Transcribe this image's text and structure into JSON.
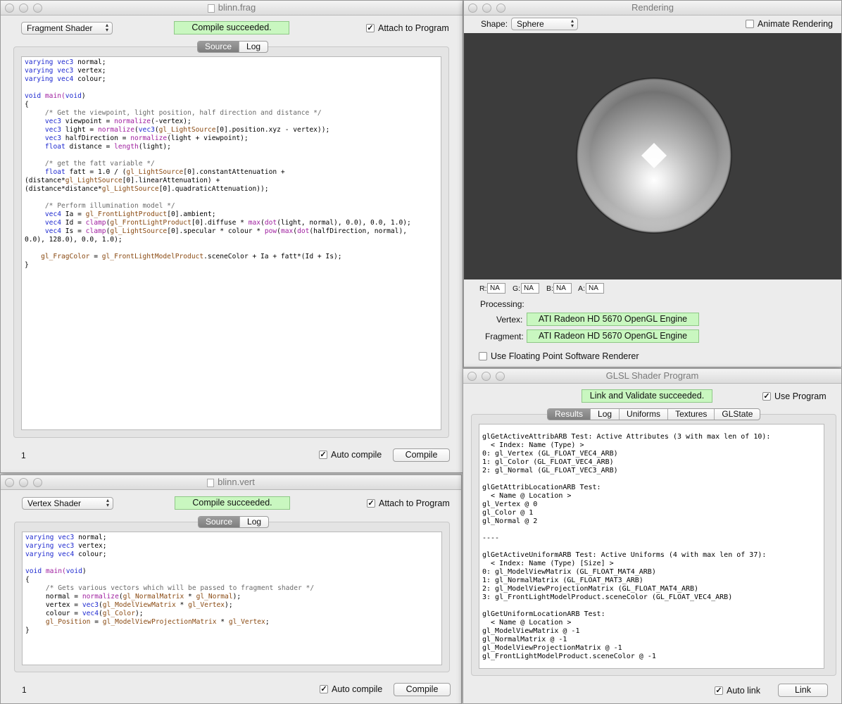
{
  "frag_window": {
    "title": "blinn.frag",
    "shader_type": "Fragment Shader",
    "status": "Compile succeeded.",
    "attach_label": "Attach to Program",
    "tabs": [
      "Source",
      "Log"
    ],
    "line_number": "1",
    "auto_compile_label": "Auto compile",
    "compile_label": "Compile",
    "code_lines": [
      [
        [
          "varying ",
          "kw"
        ],
        [
          "vec3 ",
          "kw"
        ],
        [
          "normal;",
          ""
        ]
      ],
      [
        [
          "varying ",
          "kw"
        ],
        [
          "vec3 ",
          "kw"
        ],
        [
          "vertex;",
          ""
        ]
      ],
      [
        [
          "varying ",
          "kw"
        ],
        [
          "vec4 ",
          "kw"
        ],
        [
          "colour;",
          ""
        ]
      ],
      [],
      [
        [
          "void ",
          "kw"
        ],
        [
          "main(",
          "fn"
        ],
        [
          "void",
          "kw"
        ],
        [
          ")",
          ""
        ]
      ],
      [
        [
          "{",
          ""
        ]
      ],
      [
        [
          "     /* Get the viewpoint, light position, half direction and distance */",
          "cm"
        ]
      ],
      [
        [
          "     ",
          ""
        ],
        [
          "vec3 ",
          "kw"
        ],
        [
          "viewpoint = ",
          ""
        ],
        [
          "normalize",
          "fn"
        ],
        [
          "(-vertex);",
          ""
        ]
      ],
      [
        [
          "     ",
          ""
        ],
        [
          "vec3 ",
          "kw"
        ],
        [
          "light = ",
          ""
        ],
        [
          "normalize",
          "fn"
        ],
        [
          "(",
          ""
        ],
        [
          "vec3",
          "kw"
        ],
        [
          "(",
          ""
        ],
        [
          "gl_LightSource",
          "gl"
        ],
        [
          "[0].position.xyz - vertex));",
          ""
        ]
      ],
      [
        [
          "     ",
          ""
        ],
        [
          "vec3 ",
          "kw"
        ],
        [
          "halfDirection = ",
          ""
        ],
        [
          "normalize",
          "fn"
        ],
        [
          "(light + viewpoint);",
          ""
        ]
      ],
      [
        [
          "     ",
          ""
        ],
        [
          "float ",
          "kw"
        ],
        [
          "distance = ",
          ""
        ],
        [
          "length",
          "fn"
        ],
        [
          "(light);",
          ""
        ]
      ],
      [],
      [
        [
          "     /* get the fatt variable */",
          "cm"
        ]
      ],
      [
        [
          "     ",
          ""
        ],
        [
          "float ",
          "kw"
        ],
        [
          "fatt = 1.0 / (",
          ""
        ],
        [
          "gl_LightSource",
          "gl"
        ],
        [
          "[0].constantAttenuation +",
          ""
        ]
      ],
      [
        [
          "(distance*",
          ""
        ],
        [
          "gl_LightSource",
          "gl"
        ],
        [
          "[0].linearAttenuation) +",
          ""
        ]
      ],
      [
        [
          "(distance*distance*",
          ""
        ],
        [
          "gl_LightSource",
          "gl"
        ],
        [
          "[0].quadraticAttenuation));",
          ""
        ]
      ],
      [],
      [
        [
          "     /* Perform illumination model */",
          "cm"
        ]
      ],
      [
        [
          "     ",
          ""
        ],
        [
          "vec4 ",
          "kw"
        ],
        [
          "Ia = ",
          ""
        ],
        [
          "gl_FrontLightProduct",
          "gl"
        ],
        [
          "[0].ambient;",
          ""
        ]
      ],
      [
        [
          "     ",
          ""
        ],
        [
          "vec4 ",
          "kw"
        ],
        [
          "Id = ",
          ""
        ],
        [
          "clamp",
          "fn"
        ],
        [
          "(",
          ""
        ],
        [
          "gl_FrontLightProduct",
          "gl"
        ],
        [
          "[0].diffuse * ",
          ""
        ],
        [
          "max",
          "fn"
        ],
        [
          "(",
          ""
        ],
        [
          "dot",
          "fn"
        ],
        [
          "(light, normal), 0.0), 0.0, 1.0);",
          ""
        ]
      ],
      [
        [
          "     ",
          ""
        ],
        [
          "vec4 ",
          "kw"
        ],
        [
          "Is = ",
          ""
        ],
        [
          "clamp",
          "fn"
        ],
        [
          "(",
          ""
        ],
        [
          "gl_LightSource",
          "gl"
        ],
        [
          "[0].specular * colour * ",
          ""
        ],
        [
          "pow",
          "fn"
        ],
        [
          "(",
          ""
        ],
        [
          "max",
          "fn"
        ],
        [
          "(",
          ""
        ],
        [
          "dot",
          "fn"
        ],
        [
          "(halfDirection, normal),",
          ""
        ]
      ],
      [
        [
          "0.0), 128.0), 0.0, 1.0);",
          ""
        ]
      ],
      [],
      [
        [
          "    ",
          ""
        ],
        [
          "gl_FragColor",
          "gl"
        ],
        [
          " = ",
          ""
        ],
        [
          "gl_FrontLightModelProduct",
          "gl"
        ],
        [
          ".sceneColor + Ia + fatt*(Id + Is);",
          ""
        ]
      ],
      [
        [
          "}",
          ""
        ]
      ]
    ]
  },
  "vert_window": {
    "title": "blinn.vert",
    "shader_type": "Vertex Shader",
    "status": "Compile succeeded.",
    "attach_label": "Attach to Program",
    "tabs": [
      "Source",
      "Log"
    ],
    "line_number": "1",
    "auto_compile_label": "Auto compile",
    "compile_label": "Compile",
    "code_lines": [
      [
        [
          "varying ",
          "kw"
        ],
        [
          "vec3 ",
          "kw"
        ],
        [
          "normal;",
          ""
        ]
      ],
      [
        [
          "varying ",
          "kw"
        ],
        [
          "vec3 ",
          "kw"
        ],
        [
          "vertex;",
          ""
        ]
      ],
      [
        [
          "varying ",
          "kw"
        ],
        [
          "vec4 ",
          "kw"
        ],
        [
          "colour;",
          ""
        ]
      ],
      [],
      [
        [
          "void ",
          "kw"
        ],
        [
          "main(",
          "fn"
        ],
        [
          "void",
          "kw"
        ],
        [
          ")",
          ""
        ]
      ],
      [
        [
          "{",
          ""
        ]
      ],
      [
        [
          "     /* Gets various vectors which will be passed to fragment shader */",
          "cm"
        ]
      ],
      [
        [
          "     normal = ",
          ""
        ],
        [
          "normalize",
          "fn"
        ],
        [
          "(",
          ""
        ],
        [
          "gl_NormalMatrix",
          "gl"
        ],
        [
          " * ",
          ""
        ],
        [
          "gl_Normal",
          "gl"
        ],
        [
          ");",
          ""
        ]
      ],
      [
        [
          "     vertex = ",
          ""
        ],
        [
          "vec3",
          "kw"
        ],
        [
          "(",
          ""
        ],
        [
          "gl_ModelViewMatrix",
          "gl"
        ],
        [
          " * ",
          ""
        ],
        [
          "gl_Vertex",
          "gl"
        ],
        [
          ");",
          ""
        ]
      ],
      [
        [
          "     colour = ",
          ""
        ],
        [
          "vec4",
          "kw"
        ],
        [
          "(",
          ""
        ],
        [
          "gl_Color",
          "gl"
        ],
        [
          ");",
          ""
        ]
      ],
      [
        [
          "     ",
          ""
        ],
        [
          "gl_Position",
          "gl"
        ],
        [
          " = ",
          ""
        ],
        [
          "gl_ModelViewProjectionMatrix",
          "gl"
        ],
        [
          " * ",
          ""
        ],
        [
          "gl_Vertex",
          "gl"
        ],
        [
          ";",
          ""
        ]
      ],
      [
        [
          "}",
          ""
        ]
      ]
    ]
  },
  "rendering_window": {
    "title": "Rendering",
    "shape_label": "Shape:",
    "shape_value": "Sphere",
    "animate_label": "Animate Rendering",
    "r_label": "R:",
    "r_value": "NA",
    "g_label": "G:",
    "g_value": "NA",
    "b_label": "B:",
    "b_value": "NA",
    "a_label": "A:",
    "a_value": "NA",
    "processing_label": "Processing:",
    "vertex_label": "Vertex:",
    "vertex_value": "ATI Radeon HD 5670 OpenGL Engine",
    "fragment_label": "Fragment:",
    "fragment_value": "ATI Radeon HD 5670 OpenGL Engine",
    "float_renderer_label": "Use Floating Point Software Renderer",
    "viewport_bg": "#3c3c3c"
  },
  "program_window": {
    "title": "GLSL Shader Program",
    "status": "Link and Validate succeeded.",
    "use_program_label": "Use Program",
    "tabs": [
      "Results",
      "Log",
      "Uniforms",
      "Textures",
      "GLState"
    ],
    "auto_link_label": "Auto link",
    "link_label": "Link",
    "results_lines": [
      "glGetActiveAttribARB Test: Active Attributes (3 with max len of 10):",
      "  < Index: Name (Type) >",
      "0: gl_Vertex (GL_FLOAT_VEC4_ARB)",
      "1: gl_Color (GL_FLOAT_VEC4_ARB)",
      "2: gl_Normal (GL_FLOAT_VEC3_ARB)",
      "",
      "glGetAttribLocationARB Test:",
      "  < Name @ Location >",
      "gl_Vertex @ 0",
      "gl_Color @ 1",
      "gl_Normal @ 2",
      "",
      "----",
      "",
      "glGetActiveUniformARB Test: Active Uniforms (4 with max len of 37):",
      "  < Index: Name (Type) [Size] >",
      "0: gl_ModelViewMatrix (GL_FLOAT_MAT4_ARB)",
      "1: gl_NormalMatrix (GL_FLOAT_MAT3_ARB)",
      "2: gl_ModelViewProjectionMatrix (GL_FLOAT_MAT4_ARB)",
      "3: gl_FrontLightModelProduct.sceneColor (GL_FLOAT_VEC4_ARB)",
      "",
      "glGetUniformLocationARB Test:",
      "  < Name @ Location >",
      "gl_ModelViewMatrix @ -1",
      "gl_NormalMatrix @ -1",
      "gl_ModelViewProjectionMatrix @ -1",
      "gl_FrontLightModelProduct.sceneColor @ -1"
    ]
  },
  "colors": {
    "success_green": "#c9f7c0",
    "keyword_blue": "#1f2ad0",
    "function_purple": "#a020a0",
    "comment_gray": "#6b6b6b",
    "builtin_brown": "#8a4a12"
  }
}
